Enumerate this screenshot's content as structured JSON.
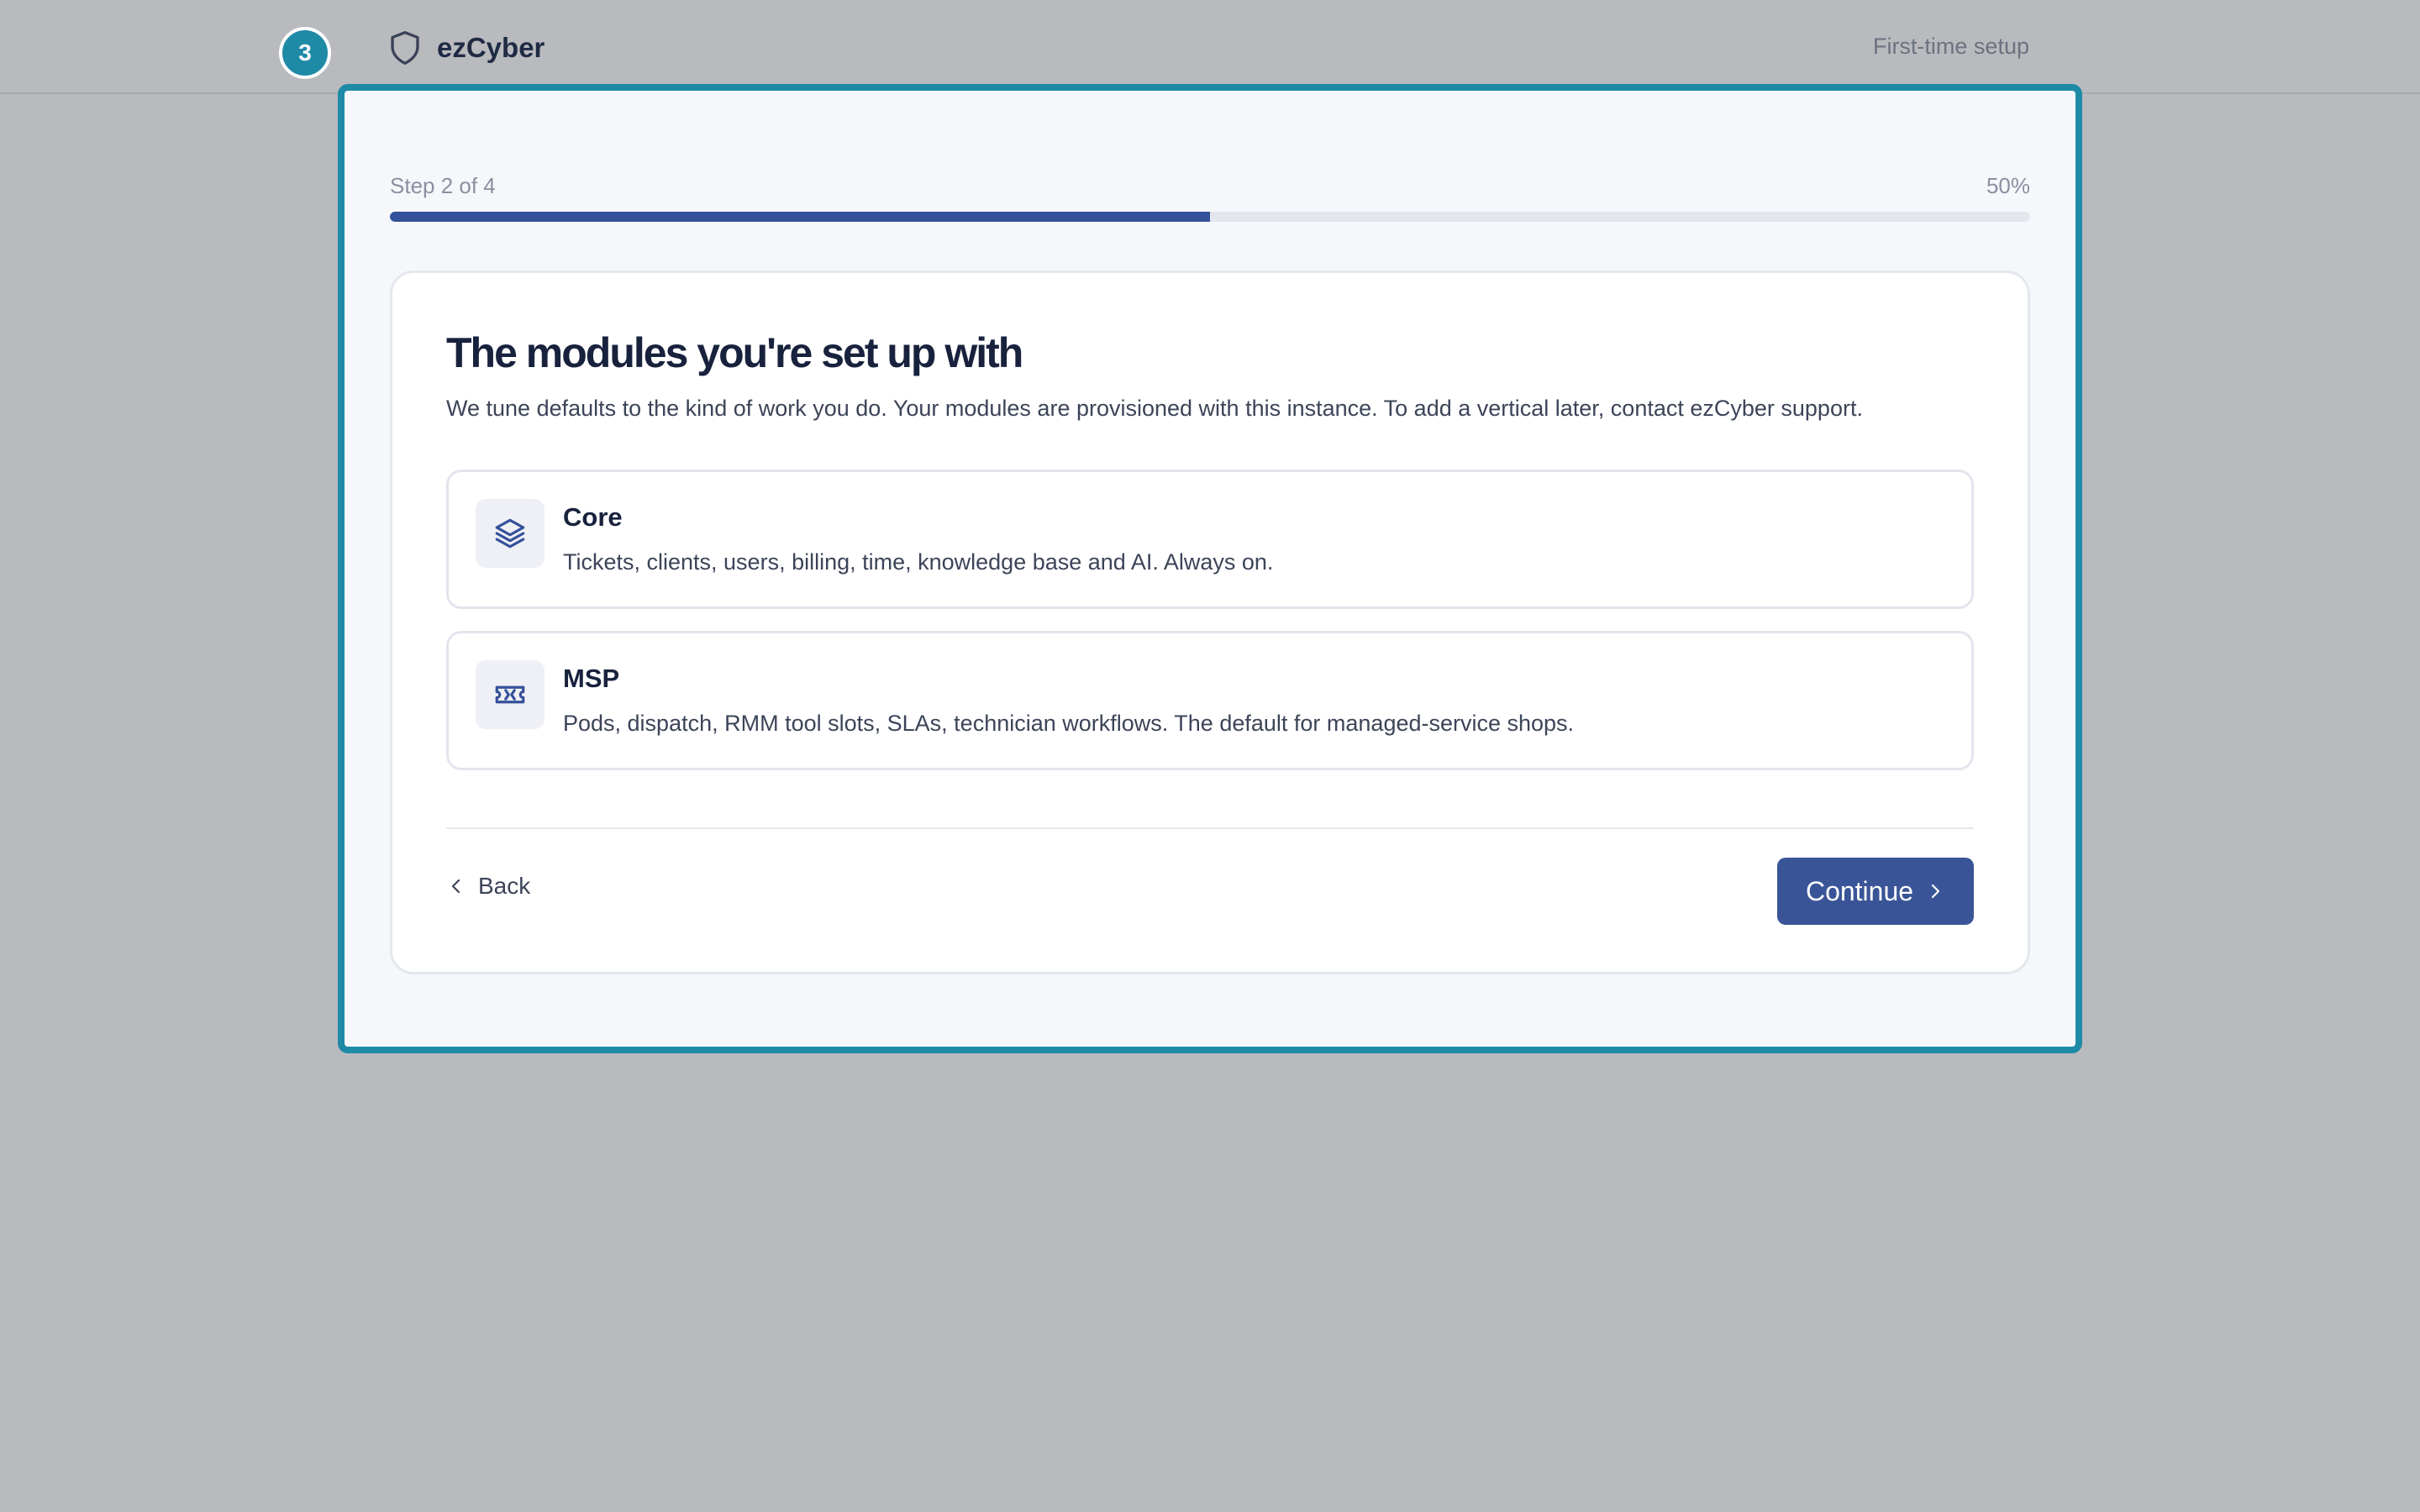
{
  "header": {
    "step_badge": "3",
    "brand_name": "ezCyber",
    "setup_label": "First-time setup"
  },
  "progress": {
    "step_label": "Step 2 of 4",
    "percent_label": "50%",
    "fraction": 0.5
  },
  "card": {
    "title": "The modules you're set up with",
    "description": "We tune defaults to the kind of work you do. Your modules are provisioned with this instance. To add a vertical later, contact ezCyber support.",
    "modules": [
      {
        "name": "Core",
        "description": "Tickets, clients, users, billing, time, knowledge base and AI. Always on.",
        "icon": "layers-icon"
      },
      {
        "name": "MSP",
        "description": "Pods, dispatch, RMM tool slots, SLAs, technician workflows. The default for managed-service shops.",
        "icon": "ticket-icon"
      }
    ],
    "back_label": "Back",
    "continue_label": "Continue"
  },
  "colors": {
    "accent": "#1f8aa6",
    "primary": "#3a5597",
    "progress_fill": "#34509a",
    "backdrop": "#b9babe"
  }
}
